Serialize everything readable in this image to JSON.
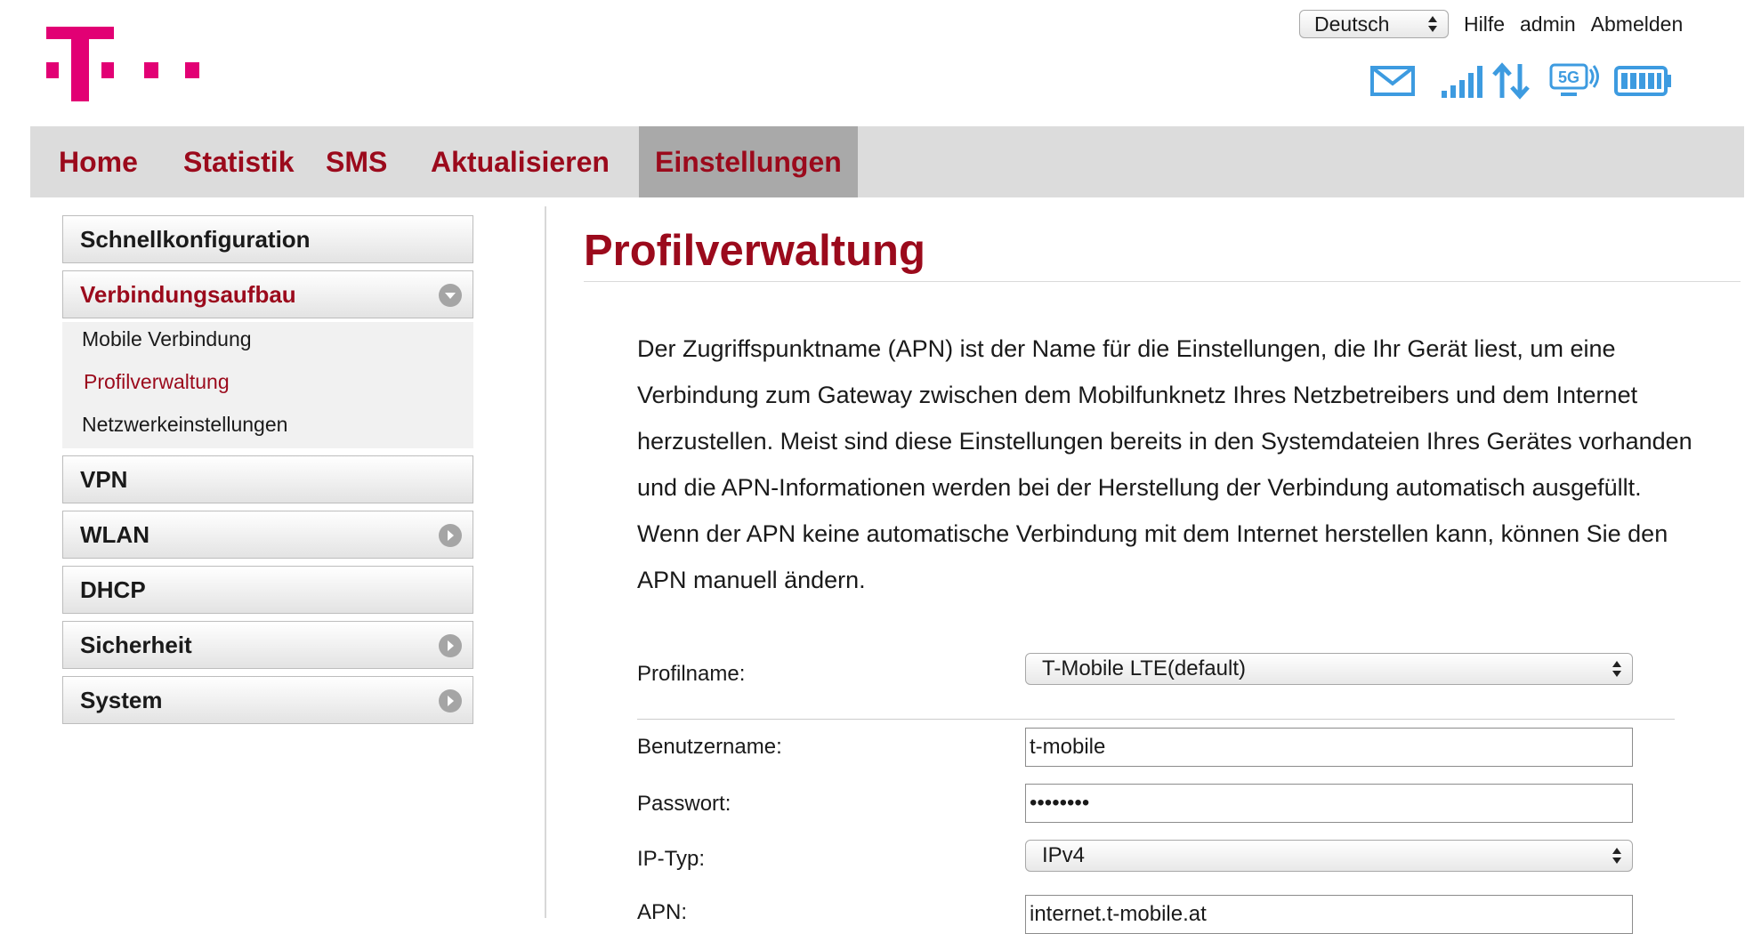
{
  "header": {
    "language": "Deutsch",
    "links": [
      "Hilfe",
      "admin",
      "Abmelden"
    ],
    "status_icons": [
      "envelope-icon",
      "signal-strength-icon",
      "data-transfer-icon",
      "5g-icon",
      "battery-icon"
    ],
    "network_badge": "5G"
  },
  "colors": {
    "brand_magenta": "#e20074",
    "accent_red": "#9b0a1c",
    "nav_bg": "#dcdcdc",
    "nav_active_bg": "#a9a9a9",
    "icon_blue": "#3d9be0"
  },
  "nav": {
    "items": [
      {
        "label": "Home"
      },
      {
        "label": "Statistik"
      },
      {
        "label": "SMS"
      },
      {
        "label": "Aktualisieren"
      },
      {
        "label": "Einstellungen",
        "active": true
      }
    ]
  },
  "sidebar": {
    "items": [
      {
        "label": "Schnellkonfiguration"
      },
      {
        "label": "Verbindungsaufbau",
        "expanded": true
      },
      {
        "label": "VPN"
      },
      {
        "label": "WLAN"
      },
      {
        "label": "DHCP"
      },
      {
        "label": "Sicherheit"
      },
      {
        "label": "System"
      }
    ],
    "subitems": [
      {
        "label": "Mobile Verbindung"
      },
      {
        "label": "Profilverwaltung",
        "active": true
      },
      {
        "label": "Netzwerkeinstellungen"
      }
    ]
  },
  "main": {
    "title": "Profilverwaltung",
    "description": "Der Zugriffspunktname (APN) ist der Name für die Einstellungen, die Ihr Gerät liest, um eine Verbindung zum Gateway zwischen dem Mobilfunknetz Ihres Netzbetreibers und dem Internet herzustellen. Meist sind diese Einstellungen bereits in den Systemdateien Ihres Gerätes vorhanden und die APN-Informationen werden bei der Herstellung der Verbindung automatisch ausgefüllt. Wenn der APN keine automatische Verbindung mit dem Internet herstellen kann, können Sie den APN manuell ändern.",
    "form": {
      "profile_label": "Profilname:",
      "profile_value": "T-Mobile LTE(default)",
      "username_label": "Benutzername:",
      "username_value": "t-mobile",
      "password_label": "Passwort:",
      "password_value": "••••••••",
      "iptype_label": "IP-Typ:",
      "iptype_value": "IPv4",
      "apn_label": "APN:",
      "apn_value": "internet.t-mobile.at"
    }
  }
}
